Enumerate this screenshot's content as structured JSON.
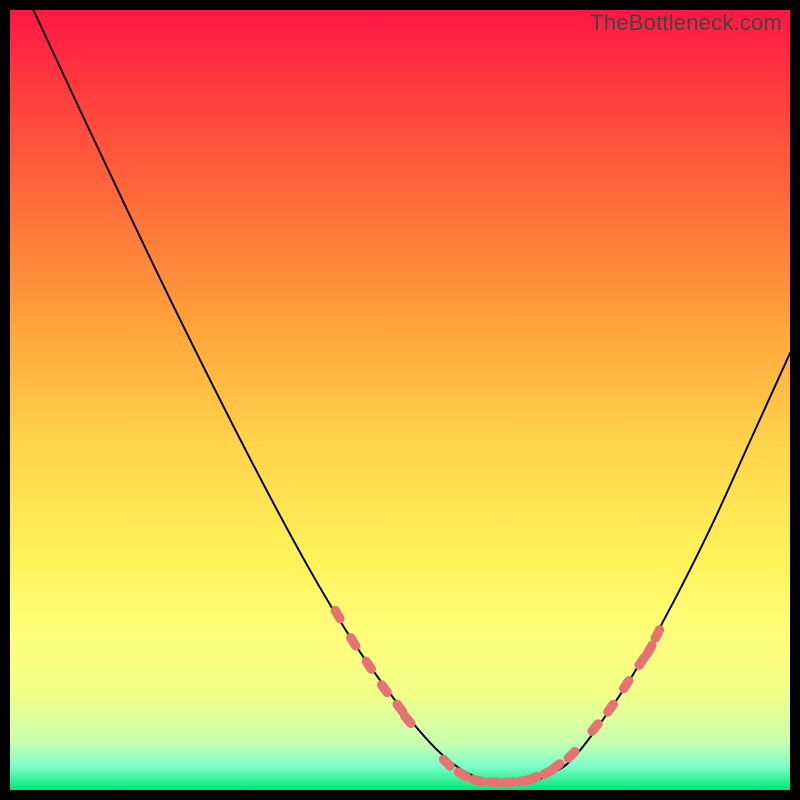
{
  "watermark": "TheBottleneck.com",
  "colors": {
    "bg": "#000000",
    "gradient_stops": [
      {
        "offset": 0.0,
        "color": "#ff1744"
      },
      {
        "offset": 0.1,
        "color": "#ff3b3f"
      },
      {
        "offset": 0.25,
        "color": "#ff6d3a"
      },
      {
        "offset": 0.4,
        "color": "#ffa23a"
      },
      {
        "offset": 0.55,
        "color": "#ffd24a"
      },
      {
        "offset": 0.7,
        "color": "#fff25a"
      },
      {
        "offset": 0.8,
        "color": "#ffff7a"
      },
      {
        "offset": 0.88,
        "color": "#f0ff8a"
      },
      {
        "offset": 0.94,
        "color": "#c8ffb0"
      },
      {
        "offset": 0.97,
        "color": "#7affc8"
      },
      {
        "offset": 1.0,
        "color": "#00e676"
      }
    ],
    "curve": "#000000",
    "markers": "#e57373"
  },
  "chart_data": {
    "type": "line",
    "title": "",
    "xlabel": "",
    "ylabel": "",
    "xlim": [
      0,
      100
    ],
    "ylim": [
      0,
      100
    ],
    "grid": false,
    "legend": false,
    "series": [
      {
        "name": "curve",
        "x": [
          3,
          10,
          20,
          30,
          38,
          44,
          49,
          53,
          56,
          59,
          62,
          65,
          67,
          69,
          71,
          73,
          76,
          80,
          85,
          90,
          95,
          100
        ],
        "y": [
          100,
          85,
          64,
          44,
          29,
          19,
          12,
          7,
          4,
          2,
          1,
          1,
          1,
          2,
          3,
          5,
          9,
          15,
          24,
          34,
          45,
          56
        ]
      }
    ],
    "markers": [
      {
        "x": 42,
        "y": 22.5
      },
      {
        "x": 44,
        "y": 19.0
      },
      {
        "x": 46,
        "y": 16.0
      },
      {
        "x": 48,
        "y": 13.0
      },
      {
        "x": 50,
        "y": 10.5
      },
      {
        "x": 51,
        "y": 9.0
      },
      {
        "x": 56,
        "y": 3.5
      },
      {
        "x": 58,
        "y": 2.0
      },
      {
        "x": 60,
        "y": 1.2
      },
      {
        "x": 62,
        "y": 1.0
      },
      {
        "x": 64,
        "y": 1.0
      },
      {
        "x": 66,
        "y": 1.2
      },
      {
        "x": 67,
        "y": 1.5
      },
      {
        "x": 69,
        "y": 2.3
      },
      {
        "x": 70,
        "y": 3.0
      },
      {
        "x": 72,
        "y": 4.5
      },
      {
        "x": 75,
        "y": 8.0
      },
      {
        "x": 77,
        "y": 10.5
      },
      {
        "x": 79,
        "y": 13.5
      },
      {
        "x": 81,
        "y": 16.5
      },
      {
        "x": 82,
        "y": 18.0
      },
      {
        "x": 83,
        "y": 20.0
      }
    ]
  }
}
